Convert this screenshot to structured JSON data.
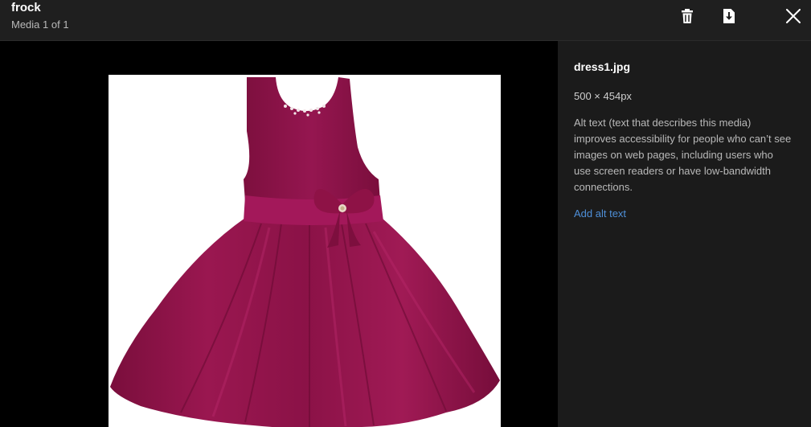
{
  "header": {
    "title": "frock",
    "counter": "Media 1 of 1"
  },
  "toolbar": {
    "delete_icon": "trash-icon",
    "download_icon": "download-icon",
    "close_icon": "close-icon"
  },
  "media": {
    "image_subject": "sleeveless maroon frock with bow at waist",
    "dress_color": "#8e1246",
    "background_color": "#ffffff"
  },
  "info_panel": {
    "filename": "dress1.jpg",
    "dimensions": "500 × 454px",
    "alt_description": "Alt text (text that describes this media) improves accessibility for people who can’t see images on web pages, including users who use screen readers or have low-bandwidth connections.",
    "add_alt_label": "Add alt text",
    "link_color": "#4e8fd8"
  }
}
